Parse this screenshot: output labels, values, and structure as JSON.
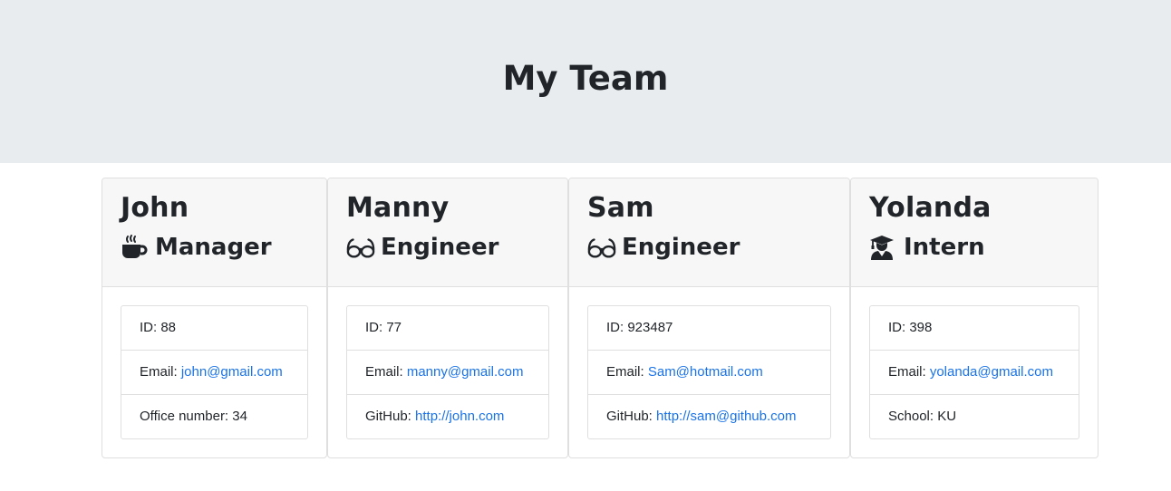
{
  "header": {
    "title": "My Team"
  },
  "cards": [
    {
      "name": "John",
      "role": "Manager",
      "icon": "coffee-icon",
      "items": [
        {
          "label": "ID: ",
          "value": "88"
        },
        {
          "label": "Email: ",
          "value": "john@gmail.com"
        },
        {
          "label": "Office number: ",
          "value": "34"
        }
      ]
    },
    {
      "name": "Manny",
      "role": "Engineer",
      "icon": "glasses-icon",
      "items": [
        {
          "label": "ID: ",
          "value": "77"
        },
        {
          "label": "Email: ",
          "value": "manny@gmail.com"
        },
        {
          "label": "GitHub: ",
          "value": "http://john.com"
        }
      ]
    },
    {
      "name": "Sam",
      "role": "Engineer",
      "icon": "glasses-icon",
      "items": [
        {
          "label": "ID: ",
          "value": "923487"
        },
        {
          "label": "Email: ",
          "value": "Sam@hotmail.com"
        },
        {
          "label": "GitHub: ",
          "value": "http://sam@github.com"
        }
      ]
    },
    {
      "name": "Yolanda",
      "role": "Intern",
      "icon": "graduate-icon",
      "items": [
        {
          "label": "ID: ",
          "value": "398"
        },
        {
          "label": "Email: ",
          "value": "yolanda@gmail.com"
        },
        {
          "label": "School: ",
          "value": "KU"
        }
      ]
    }
  ],
  "colors": {
    "jumbotron": "#e9ecef",
    "link": "#1a73e8",
    "card_header": "#f7f7f7"
  }
}
